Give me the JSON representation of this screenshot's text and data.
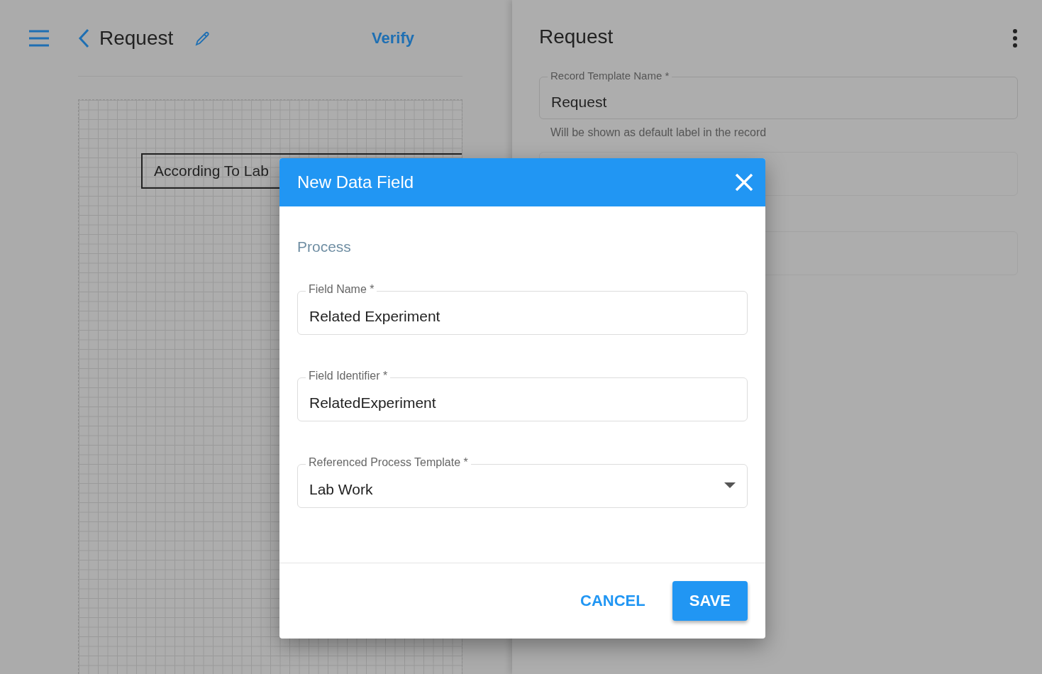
{
  "header": {
    "title": "Request",
    "action": "Verify"
  },
  "canvas": {
    "element_text": "According To Lab"
  },
  "side_panel": {
    "title": "Request",
    "fields": [
      {
        "label": "Record Template Name *",
        "value": "Request",
        "helper": "Will be shown as default label in the record"
      }
    ]
  },
  "dialog": {
    "title": "New Data Field",
    "section": "Process",
    "fields": [
      {
        "kind": "text",
        "label": "Field Name *",
        "value": "Related Experiment"
      },
      {
        "kind": "text",
        "label": "Field Identifier *",
        "value": "RelatedExperiment"
      },
      {
        "kind": "select",
        "label": "Referenced Process Template *",
        "value": "Lab Work"
      }
    ],
    "buttons": [
      {
        "kind": "text",
        "label": "CANCEL"
      },
      {
        "kind": "contained",
        "label": "SAVE"
      }
    ]
  }
}
